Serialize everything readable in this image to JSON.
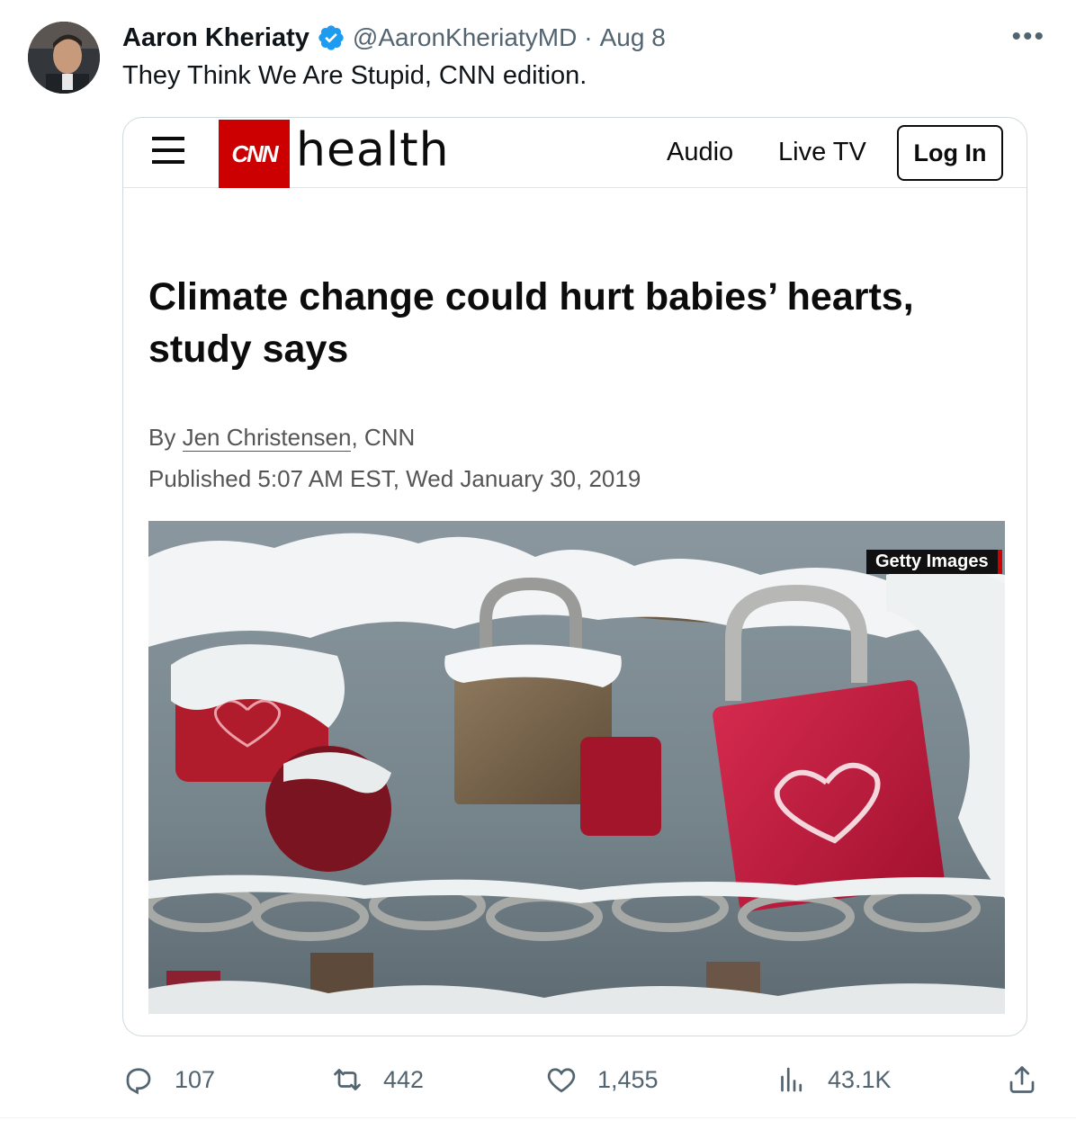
{
  "tweet": {
    "author_name": "Aaron Kheriaty",
    "verified": true,
    "handle": "@AaronKheriatyMD",
    "separator": "·",
    "date": "Aug 8",
    "text": "They Think We Are Stupid, CNN edition.",
    "more_icon": "more-horizontal-icon"
  },
  "card": {
    "site": {
      "logo_text": "CNN",
      "section": "health",
      "nav": [
        "Audio",
        "Live TV"
      ],
      "login_label": "Log In",
      "brand_color": "#cc0000"
    },
    "article": {
      "headline": "Climate change could hurt babies’ hearts, study says",
      "byline_prefix": "By ",
      "author": "Jen Christensen",
      "byline_suffix": ", CNN",
      "published": "Published 5:07 AM EST, Wed January 30, 2019",
      "photo_credit": "Getty Images",
      "photo_subject": "snow-covered padlocks on a chain, red padlock with heart"
    }
  },
  "actions": {
    "replies": "107",
    "retweets": "442",
    "likes": "1,455",
    "views": "43.1K",
    "icons": [
      "reply-icon",
      "retweet-icon",
      "like-icon",
      "views-icon",
      "share-icon"
    ]
  },
  "colors": {
    "text_primary": "#0f1419",
    "text_secondary": "#536471",
    "verified_blue": "#1d9bf0",
    "border": "#cfd9de"
  }
}
